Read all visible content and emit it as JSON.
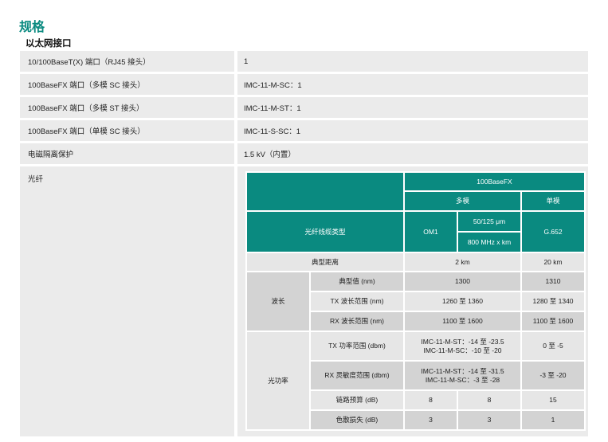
{
  "page": {
    "title": "规格",
    "section": "以太网接口"
  },
  "rows": [
    {
      "label": "10/100BaseT(X) 端口（RJ45 接头）",
      "value": "1"
    },
    {
      "label": "100BaseFX 端口（多模 SC 接头）",
      "value": "IMC-11-M-SC：1"
    },
    {
      "label": "100BaseFX 端口（多模 ST 接头）",
      "value": "IMC-11-M-ST：1"
    },
    {
      "label": "100BaseFX 端口（单模 SC 接头）",
      "value": "IMC-11-S-SC：1"
    },
    {
      "label": "电磁隔离保护",
      "value": "1.5 kV（内置）"
    },
    {
      "label": "光纤",
      "value": ""
    }
  ],
  "fiber": {
    "header": "100BaseFX",
    "multimode": "多模",
    "singlemode": "单模",
    "cable_type_label": "光纤线缆类型",
    "om1": "OM1",
    "spec1": "50/125 μm",
    "spec2": "800 MHz x km",
    "g652": "G.652",
    "distance_label": "典型距离",
    "distance_mm": "2 km",
    "distance_sm": "20 km",
    "wavelength_label": "波长",
    "typical_label": "典型值 (nm)",
    "typical_mm": "1300",
    "typical_sm": "1310",
    "tx_range_label": "TX 波长范围 (nm)",
    "tx_range_mm": "1260 至 1360",
    "tx_range_sm": "1280 至 1340",
    "rx_range_label": "RX 波长范围 (nm)",
    "rx_range_mm": "1100 至 1600",
    "rx_range_sm": "1100 至 1600",
    "power_label": "光功率",
    "tx_power_label": "TX 功率范围 (dbm)",
    "tx_power_mm_1": "IMC-11-M-ST：-14 至 -23.5",
    "tx_power_mm_2": "IMC-11-M-SC：-10 至 -20",
    "tx_power_sm": "0 至 -5",
    "rx_sens_label": "RX 灵敏度范围 (dbm)",
    "rx_sens_mm_1": "IMC-11-M-ST：-14 至 -31.5",
    "rx_sens_mm_2": "IMC-11-M-SC：-3 至 -28",
    "rx_sens_sm": "-3 至 -20",
    "budget_label": "链路预算 (dB)",
    "budget_a": "8",
    "budget_b": "8",
    "budget_c": "15",
    "dispersion_label": "色散损失 (dB)",
    "dispersion_a": "3",
    "dispersion_b": "3",
    "dispersion_c": "1"
  }
}
